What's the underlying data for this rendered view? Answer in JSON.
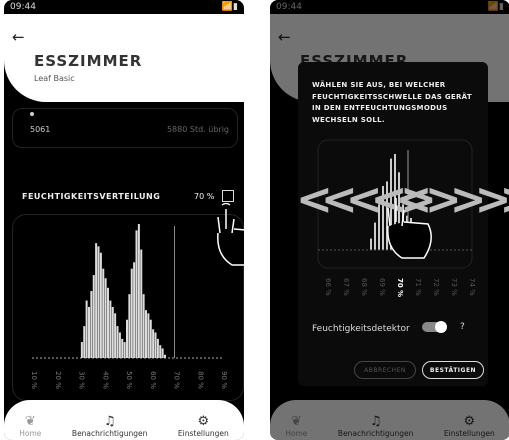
{
  "status": {
    "time": "09:44",
    "icons": "📶▮"
  },
  "header": {
    "back_glyph": "←",
    "room": "ESSZIMMER",
    "model": "Leaf Basic"
  },
  "filter": {
    "hours_used": "5061",
    "hours_left": "5880 Std. übrig"
  },
  "distribution": {
    "title": "FEUCHTIGKEITSVERTEILUNG",
    "threshold_label": "70 %",
    "edit_icon": "edit-icon"
  },
  "chart_data": {
    "type": "bar",
    "x_tick_labels": [
      "10 %",
      "20 %",
      "30 %",
      "40 %",
      "50 %",
      "60 %",
      "70 %",
      "80 %",
      "90 %"
    ],
    "xlim": [
      10,
      90
    ],
    "bins_x": [
      31,
      32,
      33,
      34,
      35,
      36,
      37,
      38,
      39,
      40,
      41,
      42,
      43,
      44,
      45,
      46,
      47,
      48,
      49,
      50,
      51,
      52,
      53,
      54,
      55,
      56,
      57,
      58,
      59,
      60,
      61,
      62,
      63,
      64,
      65,
      66
    ],
    "values": [
      5,
      10,
      18,
      16,
      21,
      26,
      36,
      35,
      33,
      28,
      25,
      22,
      18,
      16,
      14,
      10,
      8,
      6,
      5,
      12,
      20,
      28,
      30,
      40,
      42,
      34,
      20,
      15,
      14,
      12,
      9,
      8,
      6,
      4,
      3,
      1
    ],
    "threshold": 70
  },
  "nav": {
    "items": [
      {
        "label": "Home",
        "icon": "leaf-icon"
      },
      {
        "label": "Benachrichtigungen",
        "icon": "bell-icon"
      },
      {
        "label": "Einstellungen",
        "icon": "gear-icon"
      }
    ]
  },
  "modal": {
    "text": "WÄHLEN SIE AUS, BEI WELCHER FEUCHTIGKEITSSCHWELLE DAS GERÄT IN DEN ENTFEUCHTUNGSMODUS WECHSELN SOLL.",
    "tick_labels": [
      "66 %",
      "67 %",
      "68 %",
      "69 %",
      "70 %",
      "71 %",
      "72 %",
      "73 %",
      "74 %"
    ],
    "selected": "70 %",
    "detector_label": "Feuchtigkeitsdetektor",
    "detector_on": true,
    "help": "?",
    "cancel_label": "ABBRECHEN",
    "confirm_label": "BESTÄTIGEN"
  },
  "colors": {
    "background": "#000000",
    "bar": "#dddddd",
    "header": "#ffffff"
  }
}
